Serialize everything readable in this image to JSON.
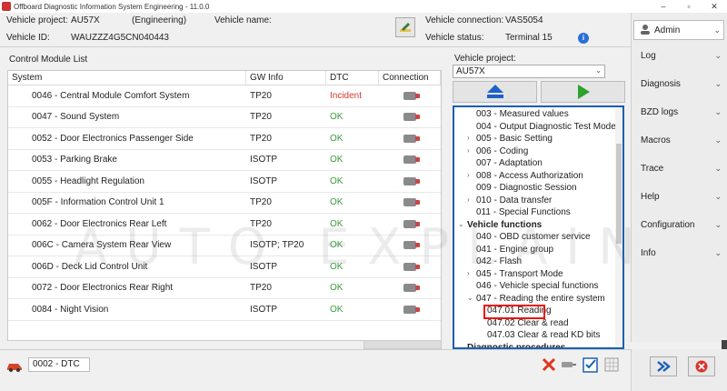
{
  "window": {
    "title": "Offboard Diagnostic Information System Engineering - 11.0.0",
    "minimize": "–",
    "restore": "▫",
    "close": "✕"
  },
  "info": {
    "vehicle_project_label": "Vehicle project:",
    "vehicle_project_value": "AU57X",
    "mode": "(Engineering)",
    "vehicle_name_label": "Vehicle name:",
    "vehicle_id_label": "Vehicle ID:",
    "vehicle_id_value": "WAUZZZ4G5CN040443",
    "vehicle_connection_label": "Vehicle connection:",
    "vehicle_connection_value": "VAS5054",
    "vehicle_status_label": "Vehicle status:",
    "vehicle_status_value": "Terminal 15"
  },
  "cml": {
    "title": "Control Module List",
    "headers": [
      "System",
      "GW Info",
      "DTC",
      "Connection"
    ],
    "rows": [
      {
        "system": "0046 - Central Module Comfort System",
        "gw": "TP20",
        "dtc": "Incident"
      },
      {
        "system": "0047 - Sound System",
        "gw": "TP20",
        "dtc": "OK"
      },
      {
        "system": "0052 - Door Electronics Passenger Side",
        "gw": "TP20",
        "dtc": "OK"
      },
      {
        "system": "0053 - Parking Brake",
        "gw": "ISOTP",
        "dtc": "OK"
      },
      {
        "system": "0055 - Headlight Regulation",
        "gw": "ISOTP",
        "dtc": "OK"
      },
      {
        "system": "005F - Information Control Unit 1",
        "gw": "TP20",
        "dtc": "OK"
      },
      {
        "system": "0062 - Door Electronics Rear Left",
        "gw": "TP20",
        "dtc": "OK"
      },
      {
        "system": "006C - Camera System Rear View",
        "gw": "ISOTP; TP20",
        "dtc": "OK"
      },
      {
        "system": "006D - Deck Lid Control Unit",
        "gw": "ISOTP",
        "dtc": "OK"
      },
      {
        "system": "0072 - Door Electronics Rear Right",
        "gw": "TP20",
        "dtc": "OK"
      },
      {
        "system": "0084 - Night Vision",
        "gw": "ISOTP",
        "dtc": "OK"
      }
    ]
  },
  "vehicle_panel": {
    "label": "Vehicle project:",
    "selected": "AU57X"
  },
  "tree": {
    "items": [
      {
        "label": "003 - Measured values",
        "arrow": ""
      },
      {
        "label": "004 - Output Diagnostic Test Mode",
        "arrow": ""
      },
      {
        "label": "005 - Basic Setting",
        "arrow": "›"
      },
      {
        "label": "006 - Coding",
        "arrow": "›"
      },
      {
        "label": "007 - Adaptation",
        "arrow": ""
      },
      {
        "label": "008 - Access Authorization",
        "arrow": "›"
      },
      {
        "label": "009 - Diagnostic Session",
        "arrow": ""
      },
      {
        "label": "010 - Data transfer",
        "arrow": "›"
      },
      {
        "label": "011 - Special Functions",
        "arrow": ""
      },
      {
        "label": "Vehicle functions",
        "arrow": "⌄",
        "category": true
      },
      {
        "label": "040 - OBD customer service",
        "arrow": ""
      },
      {
        "label": "041 - Engine group",
        "arrow": ""
      },
      {
        "label": "042 - Flash",
        "arrow": ""
      },
      {
        "label": "045 - Transport Mode",
        "arrow": "›"
      },
      {
        "label": "046 - Vehicle special functions",
        "arrow": ""
      },
      {
        "label": "047 - Reading the entire system",
        "arrow": "⌄"
      },
      {
        "label": "047.01 Reading",
        "arrow": "",
        "sub": true
      },
      {
        "label": "047.02 Clear & read",
        "arrow": "",
        "sub": true
      },
      {
        "label": "047.03 Clear & read KD bits",
        "arrow": "",
        "sub": true
      },
      {
        "label": "Diagnostic procedures",
        "arrow": "",
        "category": true
      }
    ]
  },
  "sidebar": {
    "admin": "Admin",
    "items": [
      "Log",
      "Diagnosis",
      "BZD logs",
      "Macros",
      "Trace",
      "Help",
      "Configuration",
      "Info"
    ]
  },
  "bottom": {
    "tab_label": "0002 - DTC"
  },
  "watermark": "AUTO EXPLAIN",
  "colors": {
    "ok": "#3a9a3a",
    "incident": "#d23a2a",
    "tree_border": "#1a5fb4",
    "highlight": "#e11111"
  }
}
